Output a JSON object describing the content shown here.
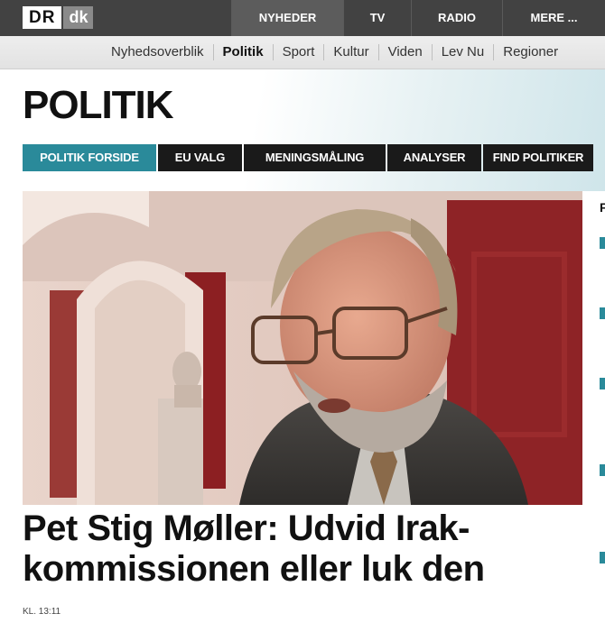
{
  "logo": {
    "part1": "DR",
    "part2": "dk"
  },
  "topnav": [
    {
      "label": "NYHEDER",
      "active": true
    },
    {
      "label": "TV"
    },
    {
      "label": "RADIO"
    },
    {
      "label": "MERE ..."
    }
  ],
  "subnav": [
    {
      "label": "Nyhedsoverblik"
    },
    {
      "label": "Politik",
      "active": true
    },
    {
      "label": "Sport"
    },
    {
      "label": "Kultur"
    },
    {
      "label": "Viden"
    },
    {
      "label": "Lev Nu"
    },
    {
      "label": "Regioner"
    }
  ],
  "section": {
    "title": "POLITIK",
    "tabs": [
      {
        "label": "POLITIK FORSIDE",
        "active": true
      },
      {
        "label": "EU VALG"
      },
      {
        "label": "MENINGSMÅLING"
      },
      {
        "label": "ANALYSER"
      },
      {
        "label": "FIND POLITIKER"
      }
    ]
  },
  "article": {
    "headline": "Pet Stig Møller: Udvid Irak-kommissionen eller luk den",
    "timestamp": "KL. 13:11"
  },
  "sidebar": {
    "letter": "F"
  },
  "colors": {
    "accent": "#2a8a9a",
    "topbar": "#424242",
    "tab_bg": "#1a1a1a"
  }
}
